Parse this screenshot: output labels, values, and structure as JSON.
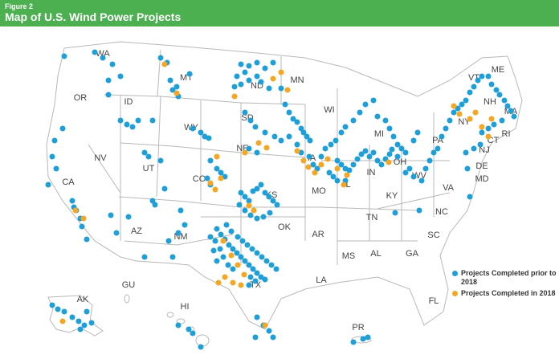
{
  "figure_label": "Figure 2",
  "title": "Map of U.S. Wind Power Projects",
  "colors": {
    "header": "#4caf50",
    "prior": "#1f9fd8",
    "recent": "#f5a623",
    "state_stroke": "#b8b8b8"
  },
  "legend": {
    "prior": "Projects Completed prior to 2018",
    "recent": "Projects Completed in 2018"
  },
  "state_labels": [
    "WA",
    "OR",
    "ID",
    "MT",
    "ND",
    "MN",
    "WI",
    "MI",
    "VT",
    "ME",
    "NH",
    "MA",
    "RI",
    "CT",
    "NY",
    "PA",
    "NJ",
    "DE",
    "MD",
    "WY",
    "SD",
    "NE",
    "IA",
    "IL",
    "IN",
    "OH",
    "WV",
    "VA",
    "NV",
    "UT",
    "CO",
    "KS",
    "MO",
    "KY",
    "CA",
    "AZ",
    "NM",
    "OK",
    "AR",
    "TN",
    "NC",
    "SC",
    "GA",
    "AL",
    "MS",
    "LA",
    "TX",
    "FL",
    "AK",
    "HI",
    "GU",
    "PR"
  ]
}
